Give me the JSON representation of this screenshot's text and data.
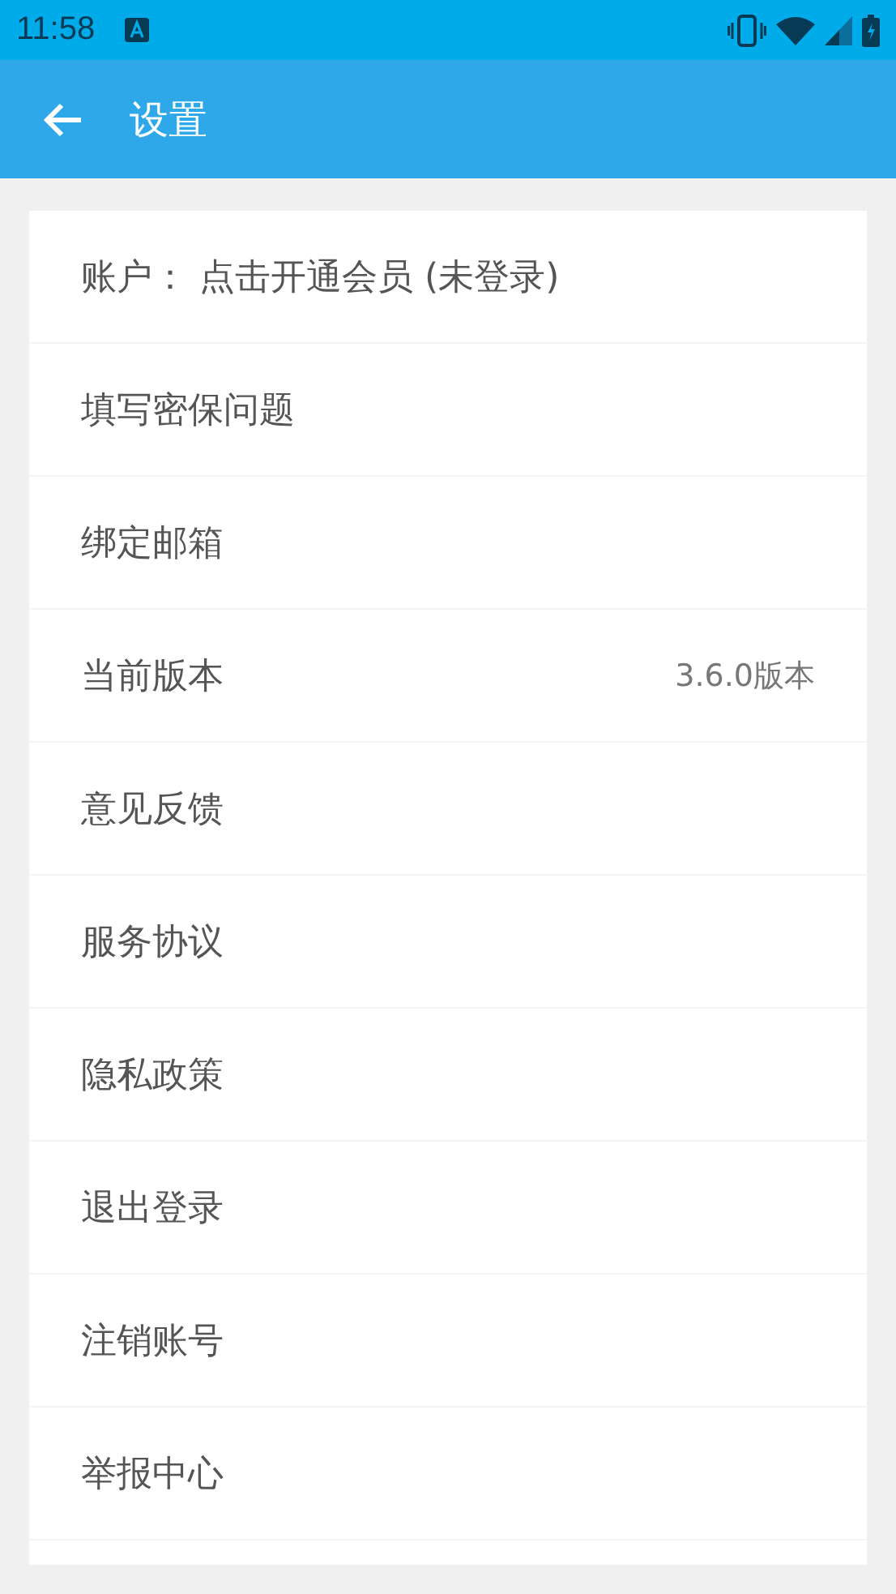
{
  "status_bar": {
    "time": "11:58"
  },
  "app_bar": {
    "title": "设置"
  },
  "settings": [
    {
      "label": "账户： 点击开通会员 (未登录)"
    },
    {
      "label": "填写密保问题"
    },
    {
      "label": "绑定邮箱"
    },
    {
      "label": "当前版本",
      "value": "3.6.0版本"
    },
    {
      "label": "意见反馈"
    },
    {
      "label": "服务协议"
    },
    {
      "label": "隐私政策"
    },
    {
      "label": "退出登录"
    },
    {
      "label": "注销账号"
    },
    {
      "label": "举报中心"
    }
  ]
}
